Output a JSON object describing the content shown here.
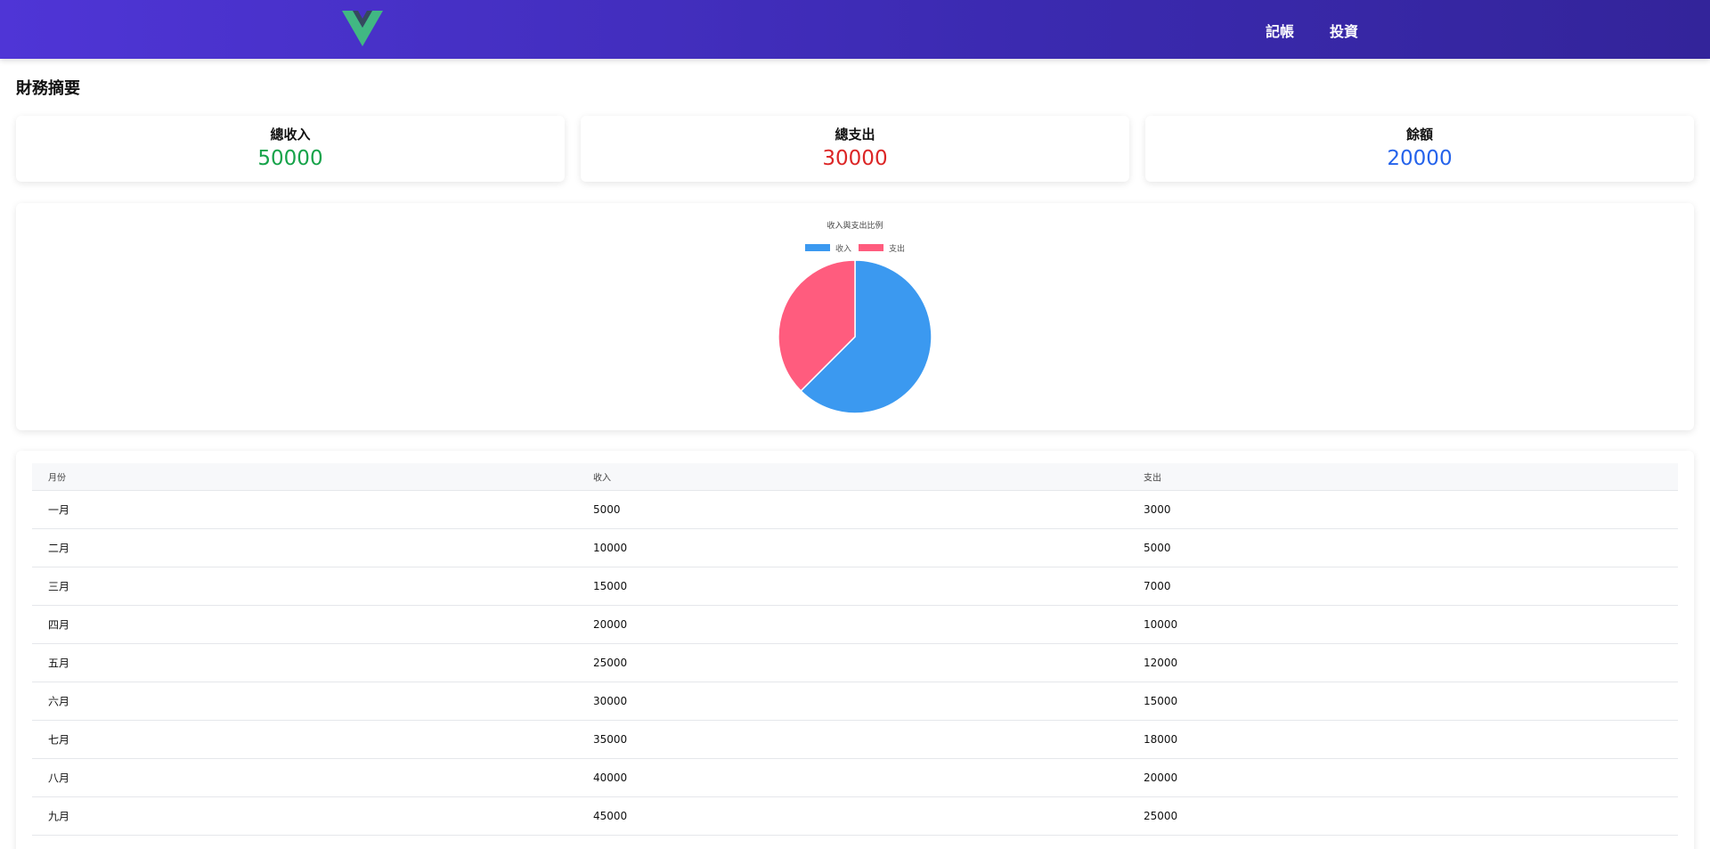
{
  "nav": {
    "items": [
      "記帳",
      "投資"
    ]
  },
  "page_title": "財務摘要",
  "summary": [
    {
      "label": "總收入",
      "value": "50000",
      "color": "#16a34a"
    },
    {
      "label": "總支出",
      "value": "30000",
      "color": "#dc2626"
    },
    {
      "label": "餘額",
      "value": "20000",
      "color": "#2563eb"
    }
  ],
  "chart_data": {
    "type": "pie",
    "title": "收入與支出比例",
    "categories": [
      "收入",
      "支出"
    ],
    "values": [
      50000,
      30000
    ],
    "colors": [
      "#3b99f0",
      "#ff5c7e"
    ],
    "legend": "top"
  },
  "table": {
    "columns": [
      "月份",
      "收入",
      "支出"
    ],
    "rows": [
      [
        "一月",
        "5000",
        "3000"
      ],
      [
        "二月",
        "10000",
        "5000"
      ],
      [
        "三月",
        "15000",
        "7000"
      ],
      [
        "四月",
        "20000",
        "10000"
      ],
      [
        "五月",
        "25000",
        "12000"
      ],
      [
        "六月",
        "30000",
        "15000"
      ],
      [
        "七月",
        "35000",
        "18000"
      ],
      [
        "八月",
        "40000",
        "20000"
      ],
      [
        "九月",
        "45000",
        "25000"
      ]
    ]
  }
}
